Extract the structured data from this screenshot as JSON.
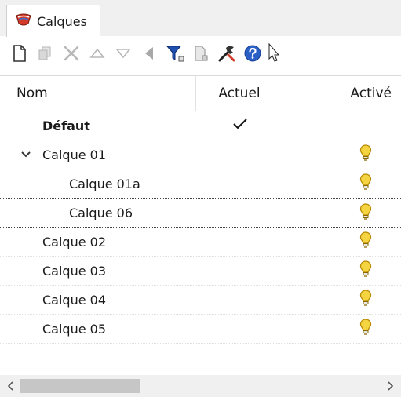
{
  "tab": {
    "label": "Calques"
  },
  "toolbar": {
    "buttons": [
      "new-layer-icon",
      "new-sublayer-icon",
      "delete-icon",
      "move-up-icon",
      "move-down-icon",
      "move-out-icon",
      "filter-icon",
      "copy-icon",
      "tools-icon",
      "help-icon"
    ]
  },
  "grid": {
    "columns": {
      "name": "Nom",
      "current": "Actuel",
      "on": "Activé"
    },
    "rows": [
      {
        "name": "Défaut",
        "indent": 0,
        "bold": true,
        "current": true,
        "on": false,
        "expander": false
      },
      {
        "name": "Calque 01",
        "indent": 0,
        "bold": false,
        "current": false,
        "on": true,
        "expander": true
      },
      {
        "name": "Calque 01a",
        "indent": 1,
        "bold": false,
        "current": false,
        "on": true,
        "expander": false
      },
      {
        "name": "Calque 06",
        "indent": 1,
        "bold": false,
        "current": false,
        "on": true,
        "expander": false,
        "selected": true
      },
      {
        "name": "Calque 02",
        "indent": 0,
        "bold": false,
        "current": false,
        "on": true,
        "expander": false
      },
      {
        "name": "Calque 03",
        "indent": 0,
        "bold": false,
        "current": false,
        "on": true,
        "expander": false
      },
      {
        "name": "Calque 04",
        "indent": 0,
        "bold": false,
        "current": false,
        "on": true,
        "expander": false
      },
      {
        "name": "Calque 05",
        "indent": 0,
        "bold": false,
        "current": false,
        "on": true,
        "expander": false
      }
    ]
  },
  "colors": {
    "accent_red": "#d23a2a",
    "bulb_yellow": "#f5d442",
    "bulb_outline": "#b88a00",
    "help_blue": "#2a5fc6",
    "filter_blue": "#2050b0"
  }
}
